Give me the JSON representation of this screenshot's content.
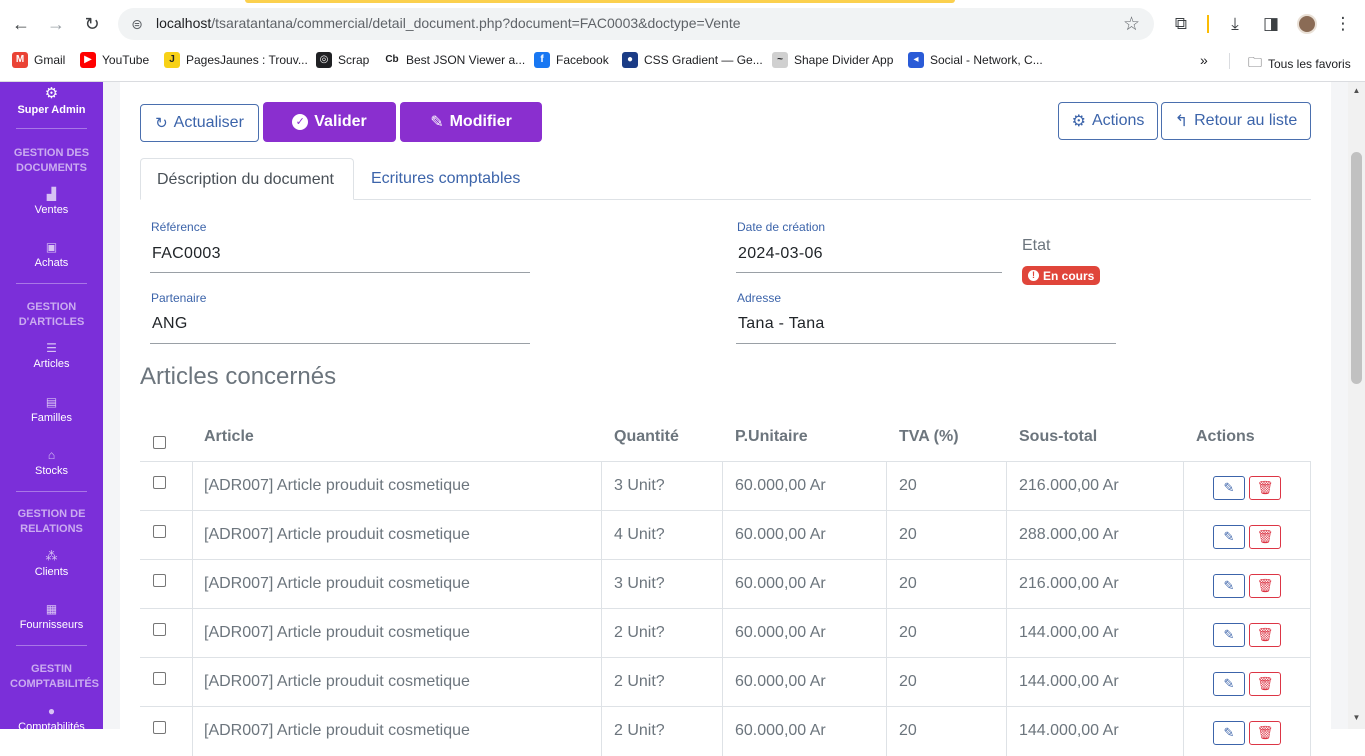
{
  "browser": {
    "url_host": "localhost",
    "url_path": "/tsaratantana/commercial/detail_document.php?document=FAC0003&doctype=Vente",
    "bookmarks": [
      {
        "label": "Gmail",
        "icon": "gmail-icon",
        "color": "#ea4335",
        "glyph": "M"
      },
      {
        "label": "YouTube",
        "icon": "youtube-icon",
        "color": "#ff0000",
        "glyph": "▶"
      },
      {
        "label": "PagesJaunes : Trouv...",
        "icon": "pagesjaunes-icon",
        "color": "#f7d117",
        "glyph": "J"
      },
      {
        "label": "Scrap",
        "icon": "globe-icon",
        "color": "#202124",
        "glyph": "◎"
      },
      {
        "label": "Best JSON Viewer a...",
        "icon": "cb-icon",
        "color": "#ffffff",
        "glyph": "Cb"
      },
      {
        "label": "Facebook",
        "icon": "facebook-icon",
        "color": "#1877f2",
        "glyph": "f"
      },
      {
        "label": "CSS Gradient — Ge...",
        "icon": "cssgradient-icon",
        "color": "#1b3c86",
        "glyph": "●"
      },
      {
        "label": "Shape Divider App",
        "icon": "shape-icon",
        "color": "#d0d0d0",
        "glyph": "~"
      },
      {
        "label": "Social - Network, C...",
        "icon": "social-icon",
        "color": "#2a5bd7",
        "glyph": "◂"
      }
    ],
    "all_bookmarks": "Tous les favoris"
  },
  "sidebar": {
    "user": "Super Admin",
    "sections": [
      {
        "heading": "GESTION DES DOCUMENTS",
        "items": [
          {
            "label": "Ventes",
            "icon": "chart-icon"
          },
          {
            "label": "Achats",
            "icon": "bag-icon"
          }
        ]
      },
      {
        "heading": "GESTION D'ARTICLES",
        "items": [
          {
            "label": "Articles",
            "icon": "list-icon"
          },
          {
            "label": "Familles",
            "icon": "card-icon"
          },
          {
            "label": "Stocks",
            "icon": "bank-icon"
          }
        ]
      },
      {
        "heading": "GESTION DE RELATIONS",
        "items": [
          {
            "label": "Clients",
            "icon": "network-icon"
          },
          {
            "label": "Fournisseurs",
            "icon": "gift-icon"
          }
        ]
      },
      {
        "heading": "GESTIN COMPTABILITÉS",
        "items": [
          {
            "label": "Comptabilités",
            "icon": "coins-icon"
          }
        ]
      }
    ]
  },
  "toolbar": {
    "refresh": "Actualiser",
    "validate": "Valider",
    "edit": "Modifier",
    "actions": "Actions",
    "back": "Retour au liste"
  },
  "tabs": [
    "Déscription du document",
    "Ecritures comptables"
  ],
  "document": {
    "reference_label": "Référence",
    "reference": "FAC0003",
    "date_label": "Date de création",
    "date": "2024-03-06",
    "etat_label": "Etat",
    "etat": "En cours",
    "partner_label": "Partenaire",
    "partner": "ANG",
    "address_label": "Adresse",
    "address": "Tana - Tana"
  },
  "articles": {
    "title": "Articles concernés",
    "columns": [
      "Article",
      "Quantité",
      "P.Unitaire",
      "TVA (%)",
      "Sous-total",
      "Actions"
    ],
    "rows": [
      {
        "article": "[ADR007] Article prouduit cosmetique",
        "qty": "3 Unit?",
        "unit_price": "60.000,00 Ar",
        "tva": "20",
        "subtotal": "216.000,00 Ar"
      },
      {
        "article": "[ADR007] Article prouduit cosmetique",
        "qty": "4 Unit?",
        "unit_price": "60.000,00 Ar",
        "tva": "20",
        "subtotal": "288.000,00 Ar"
      },
      {
        "article": "[ADR007] Article prouduit cosmetique",
        "qty": "3 Unit?",
        "unit_price": "60.000,00 Ar",
        "tva": "20",
        "subtotal": "216.000,00 Ar"
      },
      {
        "article": "[ADR007] Article prouduit cosmetique",
        "qty": "2 Unit?",
        "unit_price": "60.000,00 Ar",
        "tva": "20",
        "subtotal": "144.000,00 Ar"
      },
      {
        "article": "[ADR007] Article prouduit cosmetique",
        "qty": "2 Unit?",
        "unit_price": "60.000,00 Ar",
        "tva": "20",
        "subtotal": "144.000,00 Ar"
      },
      {
        "article": "[ADR007] Article prouduit cosmetique",
        "qty": "2 Unit?",
        "unit_price": "60.000,00 Ar",
        "tva": "20",
        "subtotal": "144.000,00 Ar"
      }
    ]
  }
}
